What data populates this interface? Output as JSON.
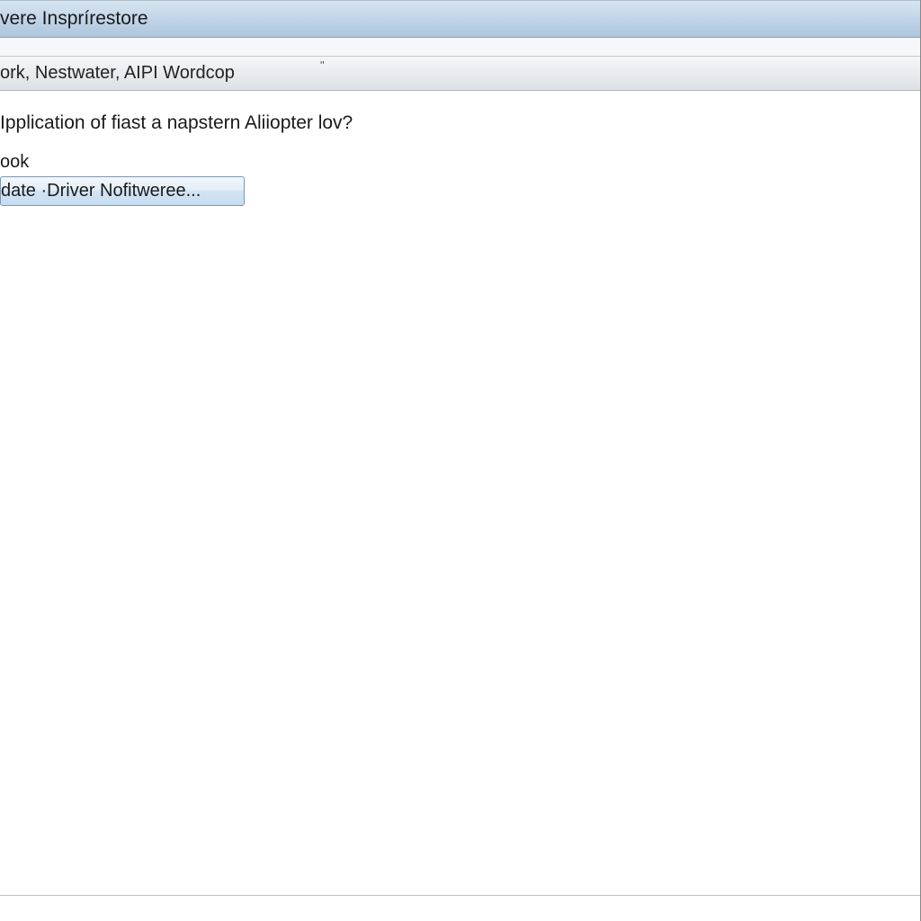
{
  "titlebar": {
    "title": "vere Insprírestore"
  },
  "toolbar": {
    "text": "ork, Nestwater, AIPI Wordcop",
    "quote": "\""
  },
  "content": {
    "question": "Ipplication of fiast a napstern Aliiopter lov?",
    "subtext": "ook",
    "button_label": "date ·Driver Nofitweree..."
  }
}
